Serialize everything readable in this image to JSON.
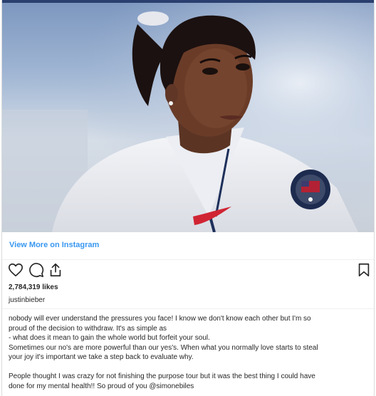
{
  "post": {
    "view_more_label": "View More on Instagram",
    "likes": "2,784,319 likes",
    "username": "justinbieber",
    "caption_lines": [
      "nobody will ever understand the pressures you face! I know we don't know each other but I'm so",
      "proud of the decision to withdraw. It's as simple as",
      "- what does it mean to gain the whole world but forfeit your soul.",
      "Sometimes our no's are more powerful than our yes's. When what you normally love starts to steal",
      "your joy it's important we take a step back to evaluate why.",
      "",
      "People thought I was crazy for not finishing the purpose tour but it was the best thing I could have",
      "done for my mental health!! So proud of you @simonebiles"
    ]
  },
  "icons": {
    "like": "heart-icon",
    "comment": "comment-icon",
    "share": "share-icon",
    "save": "bookmark-icon"
  },
  "colors": {
    "link": "#3897f0",
    "text": "#262626",
    "top_bar": "#2a3f6e"
  }
}
